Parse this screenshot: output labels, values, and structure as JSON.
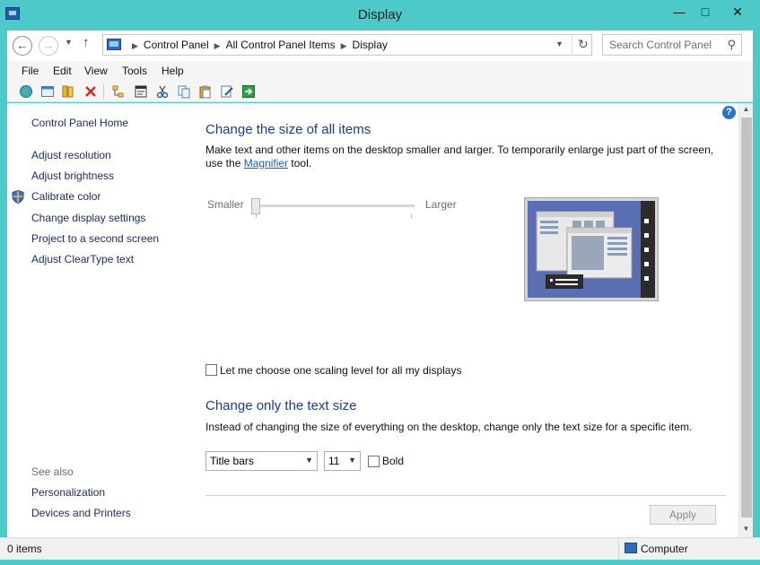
{
  "window": {
    "title": "Display"
  },
  "nav": {
    "breadcrumbs": [
      "Control Panel",
      "All Control Panel Items",
      "Display"
    ],
    "search_placeholder": "Search Control Panel"
  },
  "menu": [
    "File",
    "Edit",
    "View",
    "Tools",
    "Help"
  ],
  "toolbar_icons": [
    "globe-icon",
    "window-list-icon",
    "folder-books-icon",
    "delete-icon",
    "tree-icon",
    "properties-icon",
    "cut-icon",
    "copy-icon",
    "paste-icon",
    "edit-icon",
    "run-icon"
  ],
  "sidebar": {
    "home": "Control Panel Home",
    "items": [
      "Adjust resolution",
      "Adjust brightness",
      "Calibrate color",
      "Change display settings",
      "Project to a second screen",
      "Adjust ClearType text"
    ],
    "see_also_label": "See also",
    "see_also": [
      "Personalization",
      "Devices and Printers"
    ]
  },
  "main": {
    "size_heading": "Change the size of all items",
    "size_desc_1": "Make text and other items on the desktop smaller and larger. To temporarily enlarge just part of the screen,",
    "size_desc_2a": "use the ",
    "size_desc_link": "Magnifier",
    "size_desc_2b": " tool.",
    "slider_smaller": "Smaller",
    "slider_larger": "Larger",
    "slider_level": 0,
    "scaling_checkbox": "Let me choose one scaling level for all my displays",
    "text_heading": "Change only the text size",
    "text_desc": "Instead of changing the size of everything on the desktop, change only the text size for a specific item.",
    "item_select": "Title bars",
    "size_select": "11",
    "bold_label": "Bold",
    "apply_label": "Apply"
  },
  "status": {
    "items": "0 items",
    "location": "Computer"
  },
  "colors": {
    "frame": "#4ec9c9",
    "heading": "#1e3a8a",
    "link": "#1a5fb4"
  }
}
